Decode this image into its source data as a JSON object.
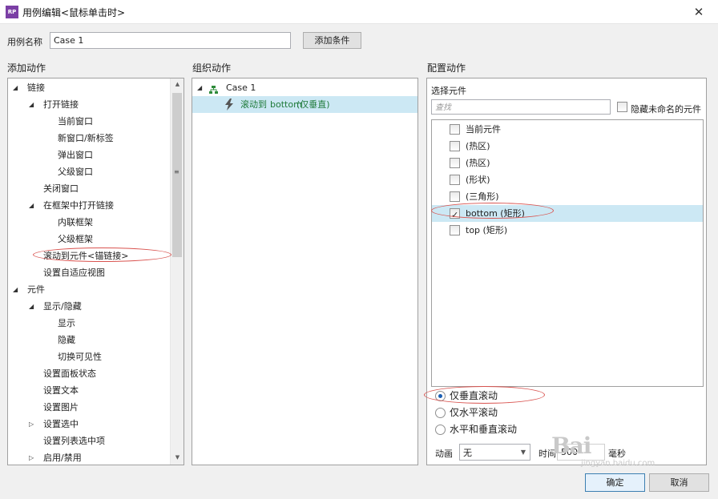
{
  "window": {
    "title": "用例编辑<鼠标单击时>",
    "icon_text": "RP",
    "close_glyph": "✕"
  },
  "case_name": {
    "label": "用例名称",
    "value": "Case 1",
    "add_condition": "添加条件"
  },
  "sections": {
    "add_actions": "添加动作",
    "organize_actions": "组织动作",
    "configure_actions": "配置动作"
  },
  "add_actions_tree": [
    {
      "label": "链接",
      "indent": 0,
      "arrow": "expanded"
    },
    {
      "label": "打开链接",
      "indent": 1,
      "arrow": "expanded"
    },
    {
      "label": "当前窗口",
      "indent": 2,
      "arrow": ""
    },
    {
      "label": "新窗口/新标签",
      "indent": 2,
      "arrow": ""
    },
    {
      "label": "弹出窗口",
      "indent": 2,
      "arrow": ""
    },
    {
      "label": "父级窗口",
      "indent": 2,
      "arrow": ""
    },
    {
      "label": "关闭窗口",
      "indent": 1,
      "arrow": ""
    },
    {
      "label": "在框架中打开链接",
      "indent": 1,
      "arrow": "expanded"
    },
    {
      "label": "内联框架",
      "indent": 2,
      "arrow": ""
    },
    {
      "label": "父级框架",
      "indent": 2,
      "arrow": ""
    },
    {
      "label": "滚动到元件<锚链接>",
      "indent": 1,
      "arrow": ""
    },
    {
      "label": "设置自适应视图",
      "indent": 1,
      "arrow": ""
    },
    {
      "label": "元件",
      "indent": 0,
      "arrow": "expanded"
    },
    {
      "label": "显示/隐藏",
      "indent": 1,
      "arrow": "expanded"
    },
    {
      "label": "显示",
      "indent": 2,
      "arrow": ""
    },
    {
      "label": "隐藏",
      "indent": 2,
      "arrow": ""
    },
    {
      "label": "切换可见性",
      "indent": 2,
      "arrow": ""
    },
    {
      "label": "设置面板状态",
      "indent": 1,
      "arrow": ""
    },
    {
      "label": "设置文本",
      "indent": 1,
      "arrow": ""
    },
    {
      "label": "设置图片",
      "indent": 1,
      "arrow": ""
    },
    {
      "label": "设置选中",
      "indent": 1,
      "arrow": "collapsed"
    },
    {
      "label": "设置列表选中项",
      "indent": 1,
      "arrow": ""
    },
    {
      "label": "启用/禁用",
      "indent": 1,
      "arrow": "collapsed"
    }
  ],
  "organize": {
    "case_label": "Case 1",
    "action_prefix": "滚动到 ",
    "action_target": "bottom",
    "action_suffix": " (仅垂直)"
  },
  "configure": {
    "select_widget": "选择元件",
    "search_placeholder": "查找",
    "hide_unnamed": "隐藏未命名的元件",
    "widgets": [
      {
        "label": "当前元件",
        "checked": false
      },
      {
        "label": "(热区)",
        "checked": false
      },
      {
        "label": "(热区)",
        "checked": false
      },
      {
        "label": "(形状)",
        "checked": false
      },
      {
        "label": "(三角形)",
        "checked": false
      },
      {
        "label": "bottom (矩形)",
        "checked": true
      },
      {
        "label": "top (矩形)",
        "checked": false
      }
    ],
    "scroll_options": [
      {
        "label": "仅垂直滚动",
        "selected": true
      },
      {
        "label": "仅水平滚动",
        "selected": false
      },
      {
        "label": "水平和垂直滚动",
        "selected": false
      }
    ],
    "animation_label": "动画",
    "animation_value": "无",
    "time_label": "时间",
    "time_value": "500",
    "ms_label": "毫秒"
  },
  "footer": {
    "ok": "确定",
    "cancel": "取消"
  },
  "watermark": {
    "text": "Bai",
    "url_fragment": "jingyan.baidu.com"
  },
  "colors": {
    "accent": "#1a5fb4",
    "selected_row": "#cce8f4",
    "annotation": "#d9534f",
    "action_text": "#1f7a3a"
  }
}
